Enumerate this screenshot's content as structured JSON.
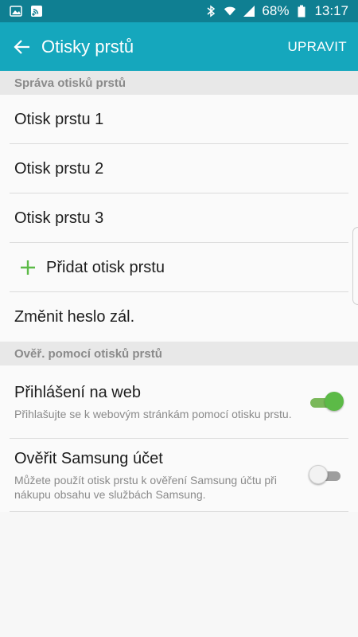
{
  "status_bar": {
    "battery": "68%",
    "time": "13:17"
  },
  "app_bar": {
    "title": "Otisky prstů",
    "action": "UPRAVIT"
  },
  "section_manage": "Správa otisků prstů",
  "fingerprints": [
    "Otisk prstu 1",
    "Otisk prstu 2",
    "Otisk prstu 3"
  ],
  "add_fingerprint": "Přidat otisk prstu",
  "change_password": "Změnit heslo zál.",
  "section_verify": "Ověř. pomocí otisků prstů",
  "web_signin": {
    "title": "Přihlášení na web",
    "subtitle": "Přihlašujte se k webovým stránkám pomocí otisku prstu.",
    "enabled": true
  },
  "samsung_account": {
    "title": "Ověřit Samsung účet",
    "subtitle": "Můžete použít otisk prstu k ověření Samsung účtu při nákupu obsahu ve službách Samsung.",
    "enabled": false
  },
  "colors": {
    "status_bar": "#0f7f92",
    "app_bar": "#15a7bd",
    "accent_green": "#5cba47"
  },
  "icons": {
    "status_left": [
      "gallery-icon",
      "cast-icon"
    ],
    "status_right": [
      "bluetooth-icon",
      "wifi-icon",
      "signal-icon",
      "battery-icon"
    ],
    "back": "back-arrow-icon",
    "add": "plus-icon"
  }
}
